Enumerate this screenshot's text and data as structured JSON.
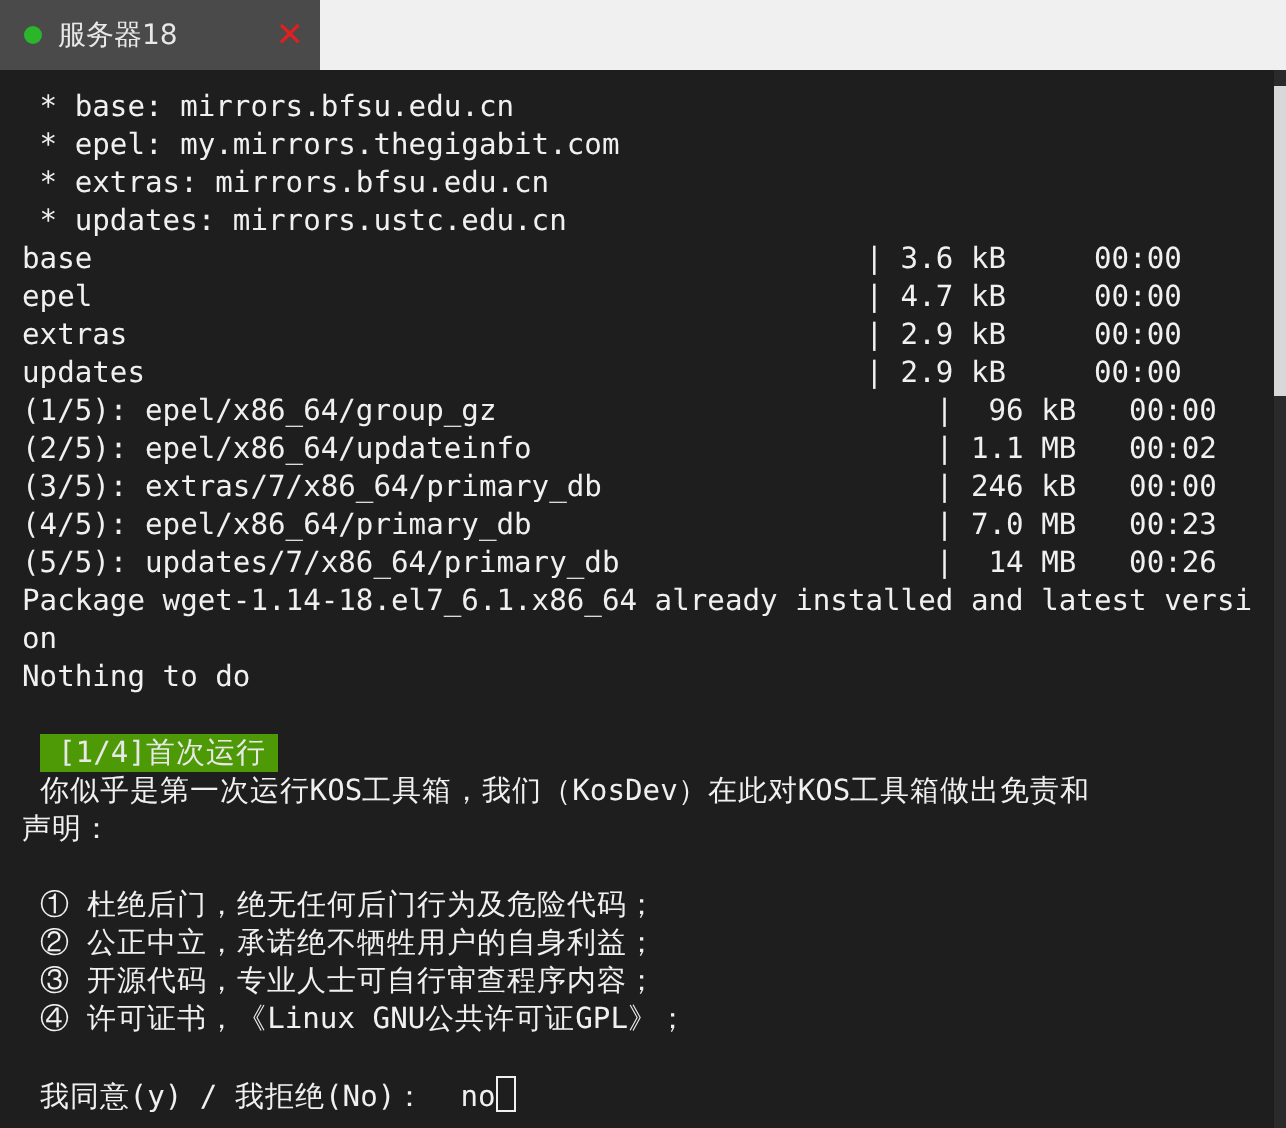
{
  "tabs": [
    {
      "label": "服务器18",
      "selected": true,
      "connected": true,
      "close": "✕"
    }
  ],
  "terminal": {
    "lines": [
      {
        "kind": "text",
        "text": " * base: mirrors.bfsu.edu.cn"
      },
      {
        "kind": "text",
        "text": " * epel: my.mirrors.thegigabit.com"
      },
      {
        "kind": "text",
        "text": " * extras: mirrors.bfsu.edu.cn"
      },
      {
        "kind": "text",
        "text": " * updates: mirrors.ustc.edu.cn"
      },
      {
        "kind": "text",
        "text": "base                                            | 3.6 kB     00:00"
      },
      {
        "kind": "text",
        "text": "epel                                            | 4.7 kB     00:00"
      },
      {
        "kind": "text",
        "text": "extras                                          | 2.9 kB     00:00"
      },
      {
        "kind": "text",
        "text": "updates                                         | 2.9 kB     00:00"
      },
      {
        "kind": "text",
        "text": "(1/5): epel/x86_64/group_gz                         |  96 kB   00:00"
      },
      {
        "kind": "text",
        "text": "(2/5): epel/x86_64/updateinfo                       | 1.1 MB   00:02"
      },
      {
        "kind": "text",
        "text": "(3/5): extras/7/x86_64/primary_db                   | 246 kB   00:00"
      },
      {
        "kind": "text",
        "text": "(4/5): epel/x86_64/primary_db                       | 7.0 MB   00:23"
      },
      {
        "kind": "text",
        "text": "(5/5): updates/7/x86_64/primary_db                  |  14 MB   00:26"
      },
      {
        "kind": "text",
        "text": "Package wget-1.14-18.el7_6.1.x86_64 already installed and latest versi"
      },
      {
        "kind": "text",
        "text": "on"
      },
      {
        "kind": "text",
        "text": "Nothing to do"
      },
      {
        "kind": "blank"
      },
      {
        "kind": "highlight",
        "text": "[1/4]首次运行"
      },
      {
        "kind": "text",
        "text": " 你似乎是第一次运行KOS工具箱，我们（KosDev）在此对KOS工具箱做出免责和"
      },
      {
        "kind": "text",
        "text": "声明："
      },
      {
        "kind": "blank"
      },
      {
        "kind": "text",
        "text": " ① 杜绝后门，绝无任何后门行为及危险代码；"
      },
      {
        "kind": "text",
        "text": " ② 公正中立，承诺绝不牺牲用户的自身利益；"
      },
      {
        "kind": "text",
        "text": " ③ 开源代码，专业人士可自行审查程序内容；"
      },
      {
        "kind": "text",
        "text": " ④ 许可证书，《Linux GNU公共许可证GPL》；"
      },
      {
        "kind": "blank"
      },
      {
        "kind": "prompt",
        "text": " 我同意(y) / 我拒绝(No)：  ",
        "value": "no"
      }
    ]
  }
}
